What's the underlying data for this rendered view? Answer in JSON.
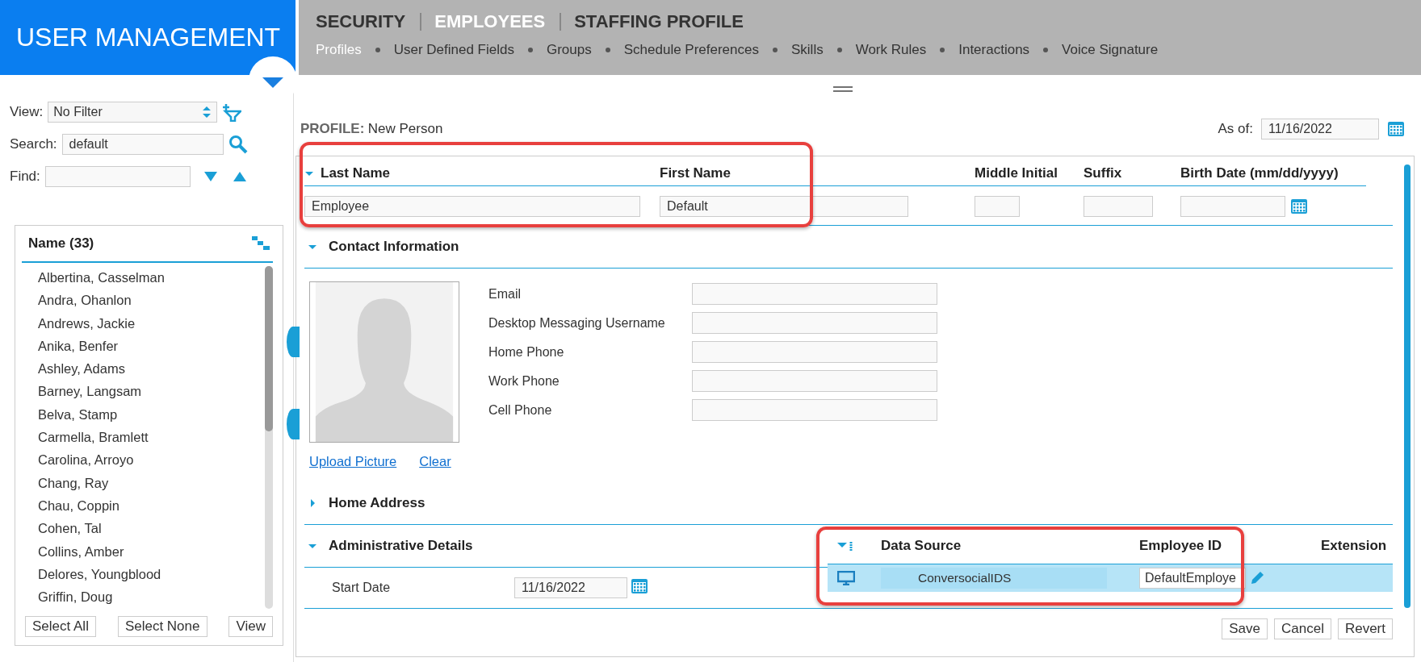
{
  "header": {
    "title": "USER MANAGEMENT",
    "top_tabs": [
      {
        "label": "SECURITY",
        "selected": false
      },
      {
        "label": "EMPLOYEES",
        "selected": true
      },
      {
        "label": "STAFFING PROFILE",
        "selected": false
      }
    ],
    "sub_tabs": [
      {
        "label": "Profiles",
        "selected": true
      },
      {
        "label": "User Defined Fields",
        "selected": false
      },
      {
        "label": "Groups",
        "selected": false
      },
      {
        "label": "Schedule Preferences",
        "selected": false
      },
      {
        "label": "Skills",
        "selected": false
      },
      {
        "label": "Work Rules",
        "selected": false
      },
      {
        "label": "Interactions",
        "selected": false
      },
      {
        "label": "Voice Signature",
        "selected": false
      }
    ]
  },
  "filter": {
    "view_label": "View:",
    "view_value": "No Filter",
    "search_label": "Search:",
    "search_value": "default",
    "find_label": "Find:"
  },
  "name_list": {
    "title": "Name (33)",
    "items": [
      "Albertina, Casselman",
      "Andra, Ohanlon",
      "Andrews, Jackie",
      "Anika, Benfer",
      "Ashley, Adams",
      "Barney, Langsam",
      "Belva, Stamp",
      "Carmella, Bramlett",
      "Carolina, Arroyo",
      "Chang, Ray",
      "Chau, Coppin",
      "Cohen, Tal",
      "Collins, Amber",
      "Delores, Youngblood",
      "Griffin, Doug"
    ],
    "buttons": [
      "Select All",
      "Select None",
      "View"
    ]
  },
  "profile": {
    "label": "PROFILE:",
    "name": "New Person",
    "as_of_label": "As of:",
    "as_of": "11/16/2022"
  },
  "name_section": {
    "highlighted": true,
    "expanded": true,
    "fields": [
      {
        "label": "Last Name",
        "value": "Employee"
      },
      {
        "label": "First Name",
        "value": "Default"
      },
      {
        "label": "Middle Initial"
      },
      {
        "label": "Suffix"
      },
      {
        "label": "Birth Date (mm/dd/yyyy)"
      }
    ]
  },
  "contact": {
    "title": "Contact Information",
    "expanded": true,
    "links": [
      "Upload Picture",
      "Clear"
    ],
    "fields": [
      "Email",
      "Desktop Messaging Username",
      "Home Phone",
      "Work Phone",
      "Cell Phone"
    ]
  },
  "home_address": {
    "title": "Home Address",
    "expanded": false
  },
  "admin": {
    "title": "Administrative Details",
    "expanded": true,
    "start_date_label": "Start Date",
    "start_date": "11/16/2022",
    "table": {
      "highlighted": true,
      "columns": [
        "Data Source",
        "Employee ID",
        "Extension"
      ],
      "rows": [
        {
          "data_source": "ConversocialIDS",
          "employee_id": "DefaultEmploye",
          "selected": true
        }
      ]
    }
  },
  "actions": [
    "Save",
    "Cancel",
    "Revert"
  ]
}
